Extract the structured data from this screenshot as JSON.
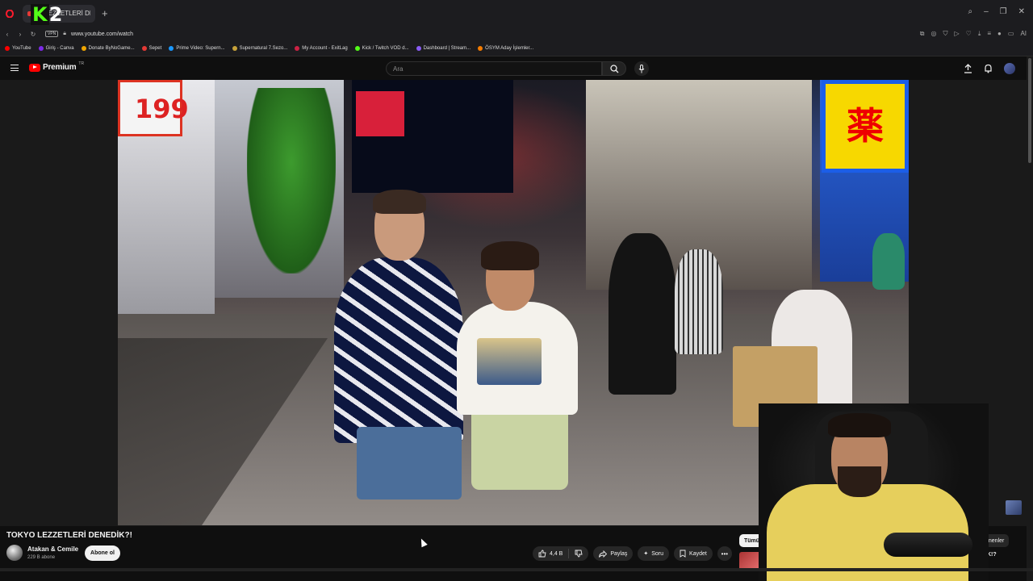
{
  "browser": {
    "tab_label": "LEZZETLERİ DE",
    "overlay_brand_k": "K",
    "overlay_brand_num": "2",
    "url": "www.youtube.com/watch",
    "vpn_label": "VPN",
    "ai_label": "AI",
    "bookmarks": [
      {
        "label": "YouTube",
        "color": "#ff0000"
      },
      {
        "label": "Giriş - Canva",
        "color": "#7d2ae8"
      },
      {
        "label": "Donate ByNoGame...",
        "color": "#f0a500"
      },
      {
        "label": "Sepet",
        "color": "#e53935"
      },
      {
        "label": "Prime Video: Supern...",
        "color": "#1a98ff"
      },
      {
        "label": "Supernatural 7.Sezo...",
        "color": "#c7a23a"
      },
      {
        "label": "My Account - ExitLag",
        "color": "#cc2244"
      },
      {
        "label": "Kick / Twitch VOD d...",
        "color": "#53fc18"
      },
      {
        "label": "Dashboard | Stream...",
        "color": "#8a5cf6"
      },
      {
        "label": "ÖSYM Aday İşlemler...",
        "color": "#f57c00"
      }
    ]
  },
  "youtube": {
    "logo_text": "Premium",
    "logo_region": "TR",
    "search_placeholder": "Ara",
    "video_title": "TOKYO LEZZETLERİ DENEDİK?!",
    "channel_name": "Atakan & Cemile",
    "channel_subs": "229 B abone",
    "subscribe_label": "Abone ol",
    "like_count": "4,4 B",
    "share_label": "Paylaş",
    "ask_label": "Soru",
    "save_label": "Kaydet",
    "chips": {
      "all": "Tümü",
      "watched": "İzlenenler"
    },
    "rec_fragment": "DİK!?",
    "video_signs": {
      "left_sign": "199",
      "right_sign": "薬"
    }
  },
  "icons": [
    "menu-icon",
    "search-icon",
    "mic-icon",
    "upload-icon",
    "bell-icon",
    "like-icon",
    "dislike-icon",
    "share-icon",
    "sparkle-icon",
    "bookmark-icon",
    "more-icon"
  ]
}
